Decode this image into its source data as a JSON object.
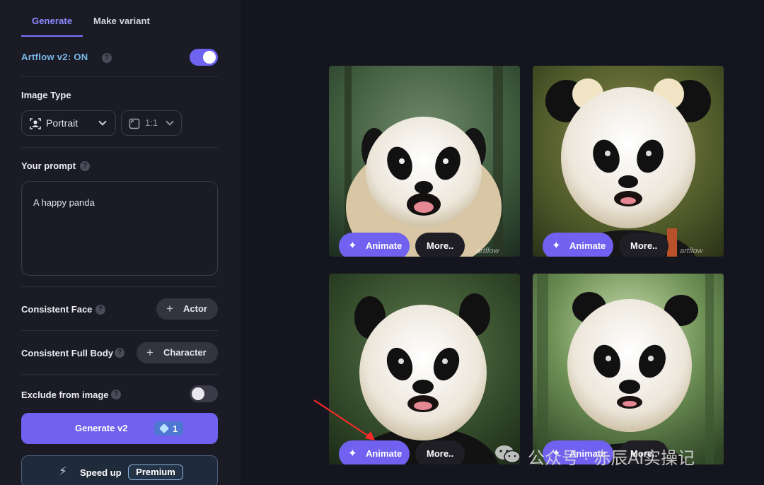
{
  "tabs": {
    "generate": "Generate",
    "variant": "Make variant"
  },
  "artflow": {
    "label": "Artflow v2: ON",
    "enabled": true
  },
  "image_type": {
    "label": "Image Type",
    "style_value": "Portrait",
    "ratio_value": "1:1"
  },
  "prompt": {
    "label": "Your prompt",
    "value": "A happy panda"
  },
  "consistent_face": {
    "label": "Consistent Face",
    "button": "Actor"
  },
  "consistent_body": {
    "label": "Consistent Full Body",
    "button": "Character"
  },
  "exclude": {
    "label": "Exclude from image",
    "enabled": false
  },
  "generate": {
    "label": "Generate v2",
    "credits": "1"
  },
  "speed_up": {
    "label": "Speed up",
    "badge": "Premium"
  },
  "results": [
    {
      "animate": "Animate",
      "more": "More..",
      "watermark": "artflow"
    },
    {
      "animate": "Animate",
      "more": "More..",
      "watermark": "artflow"
    },
    {
      "animate": "Animate",
      "more": "More.."
    },
    {
      "animate": "Animate",
      "more": "More.."
    }
  ],
  "overlay": {
    "wechat_text": "公众号 · 赤辰AI实操记"
  },
  "colors": {
    "accent": "#7061f0",
    "bg": "#15151f",
    "sidebar": "#1b1b26",
    "artflow_label": "#79b8ea"
  }
}
